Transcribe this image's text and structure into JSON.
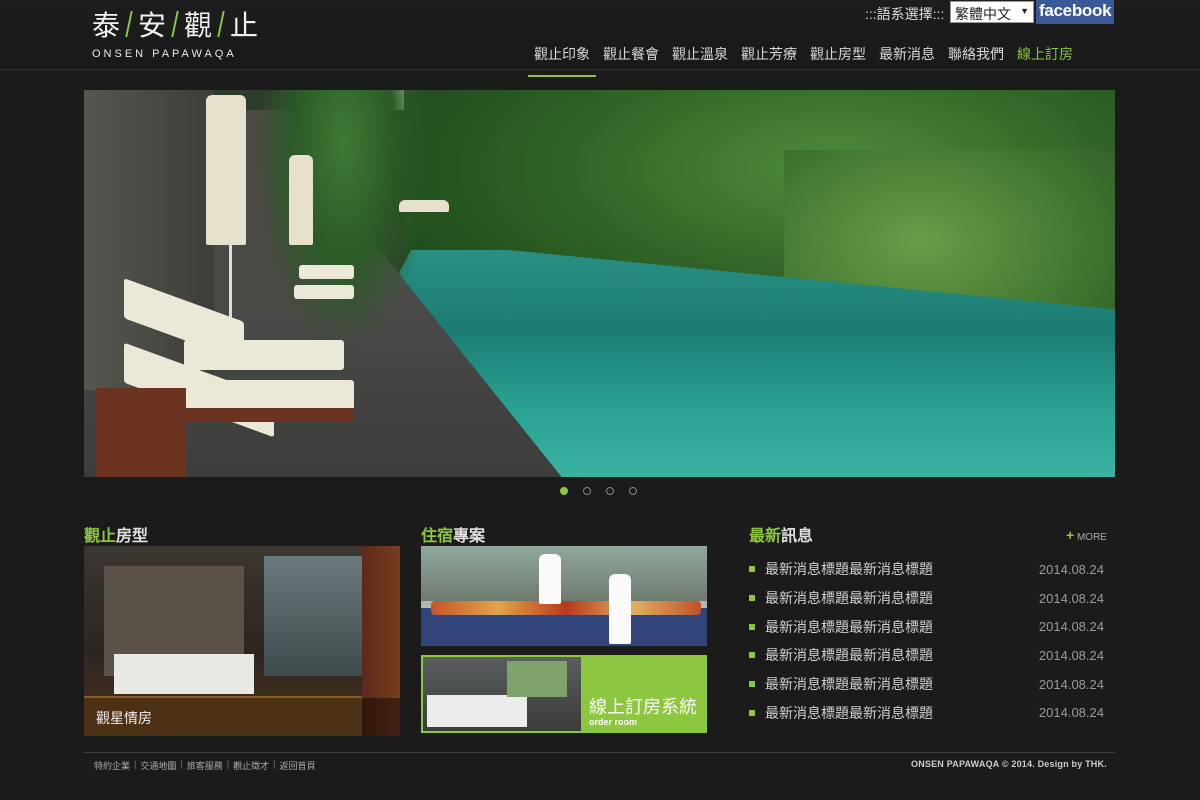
{
  "header": {
    "logo_cn": [
      "泰",
      "安",
      "觀",
      "止"
    ],
    "logo_en": "ONSEN PAPAWAQA",
    "lang_label": ":::語系選擇:::",
    "lang_selected": "繁體中文",
    "facebook": "facebook"
  },
  "nav": {
    "items": [
      {
        "label": "觀止印象"
      },
      {
        "label": "觀止餐會"
      },
      {
        "label": "觀止溫泉"
      },
      {
        "label": "觀止芳療"
      },
      {
        "label": "觀止房型"
      },
      {
        "label": "最新消息"
      },
      {
        "label": "聯絡我們"
      },
      {
        "label": "線上訂房"
      }
    ]
  },
  "rooms": {
    "title_green": "觀止",
    "title_white": "房型",
    "caption": "觀星情房"
  },
  "projects": {
    "title_green": "住宿",
    "title_white": "專案",
    "booking_label": "線上訂房系統",
    "booking_sub": "order room"
  },
  "news": {
    "title_green": "最新",
    "title_white": "訊息",
    "more_plus": "+",
    "more_label": "MORE",
    "items": [
      {
        "title": "最新消息標題最新消息標題",
        "date": "2014.08.24"
      },
      {
        "title": "最新消息標題最新消息標題",
        "date": "2014.08.24"
      },
      {
        "title": "最新消息標題最新消息標題",
        "date": "2014.08.24"
      },
      {
        "title": "最新消息標題最新消息標題",
        "date": "2014.08.24"
      },
      {
        "title": "最新消息標題最新消息標題",
        "date": "2014.08.24"
      },
      {
        "title": "最新消息標題最新消息標題",
        "date": "2014.08.24"
      }
    ]
  },
  "footer": {
    "links": [
      "特約企業",
      "交通地圖",
      "旅客服務",
      "觀止徵才",
      "返回首頁"
    ],
    "copyright": "ONSEN PAPAWAQA © 2014. Design by THK."
  },
  "colors": {
    "accent": "#8dc63f",
    "background": "#1b1b1b",
    "facebook": "#3b5998"
  }
}
